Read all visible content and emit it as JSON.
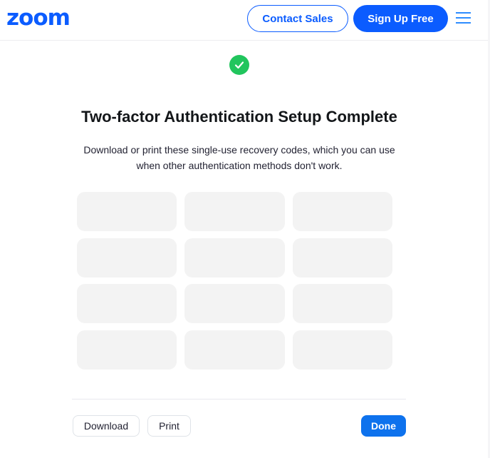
{
  "header": {
    "logo_text": "zoom",
    "contact_sales_label": "Contact Sales",
    "sign_up_label": "Sign Up Free",
    "menu_icon": "hamburger-menu-icon"
  },
  "main": {
    "status_icon": "check-circle-icon",
    "title": "Two-factor Authentication Setup Complete",
    "description": "Download or print these single-use recovery codes, which you can use when other authentication methods don't work.",
    "recovery_codes": [
      "",
      "",
      "",
      "",
      "",
      "",
      "",
      "",
      "",
      "",
      "",
      ""
    ]
  },
  "footer": {
    "download_label": "Download",
    "print_label": "Print",
    "done_label": "Done"
  },
  "colors": {
    "brand": "#0b5cff",
    "success": "#21c55d",
    "primary_button": "#0e72ed",
    "tile_background": "#f3f3f3"
  }
}
